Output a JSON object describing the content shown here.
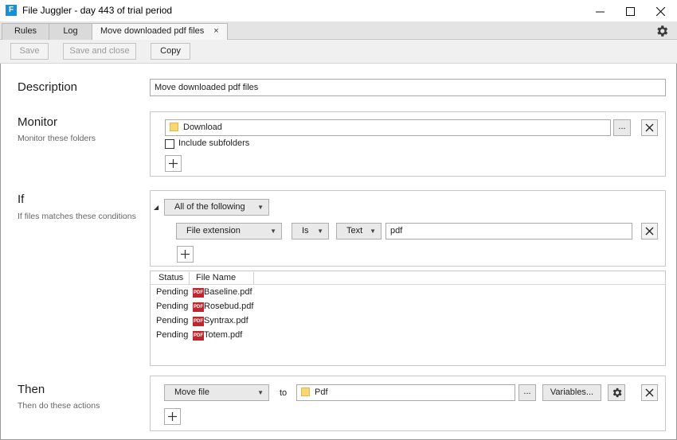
{
  "window": {
    "title": "File Juggler - day 443 of trial period",
    "app_icon_letter": "F",
    "minimize": "—",
    "maximize": "☐",
    "close": "✕"
  },
  "tabs": [
    {
      "label": "Rules"
    },
    {
      "label": "Log"
    },
    {
      "label": "Move downloaded pdf files",
      "close": "×"
    }
  ],
  "toolbar": {
    "save_label": "Save",
    "save_close_label": "Save and close",
    "copy_label": "Copy"
  },
  "description": {
    "title": "Description",
    "value": "Move downloaded pdf files"
  },
  "monitor": {
    "title": "Monitor",
    "subtitle": "Monitor these folders",
    "folder": "Download",
    "browse_label": "...",
    "include_subfolders_label": "Include subfolders",
    "include_subfolders_checked": false
  },
  "if": {
    "title": "If",
    "subtitle": "If files matches these conditions",
    "collapse_glyph": "◢",
    "group_mode": "All of the following",
    "condition": {
      "field": "File extension",
      "operator": "Is",
      "type": "Text",
      "value": "pdf"
    }
  },
  "files": {
    "columns": [
      "Status",
      "File Name"
    ],
    "rows": [
      {
        "status": "Pending",
        "name": "Baseline.pdf"
      },
      {
        "status": "Pending",
        "name": "Rosebud.pdf"
      },
      {
        "status": "Pending",
        "name": "Syntrax.pdf"
      },
      {
        "status": "Pending",
        "name": "Totem.pdf"
      }
    ],
    "icon_label": "PDF"
  },
  "then": {
    "title": "Then",
    "subtitle": "Then do these actions",
    "action": "Move file",
    "to_label": "to",
    "destination": "Pdf",
    "browse_label": "...",
    "variables_label": "Variables..."
  },
  "colors": {
    "accent": "#1b8fd6",
    "pdf_red": "#c0272d",
    "folder_yellow": "#f7d774"
  }
}
